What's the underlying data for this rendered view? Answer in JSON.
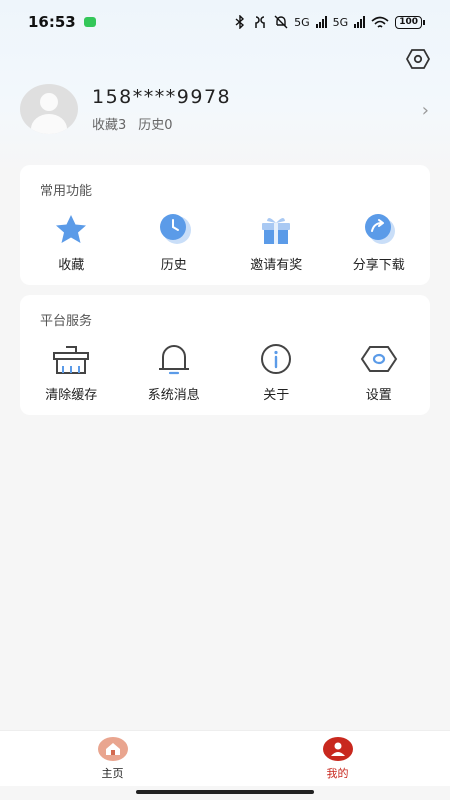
{
  "status_bar": {
    "time": "16:53",
    "network": "5G",
    "network2": "5G",
    "battery": "100"
  },
  "profile": {
    "phone": "158****9978",
    "favorites": "收藏3",
    "history": "历史0"
  },
  "common_functions": {
    "title": "常用功能",
    "items": [
      {
        "label": "收藏",
        "icon": "star-icon"
      },
      {
        "label": "历史",
        "icon": "clock-icon"
      },
      {
        "label": "邀请有奖",
        "icon": "gift-icon"
      },
      {
        "label": "分享下载",
        "icon": "share-icon"
      }
    ]
  },
  "platform_services": {
    "title": "平台服务",
    "items": [
      {
        "label": "清除缓存",
        "icon": "broom-icon"
      },
      {
        "label": "系统消息",
        "icon": "bell-icon"
      },
      {
        "label": "关于",
        "icon": "info-icon"
      },
      {
        "label": "设置",
        "icon": "settings-icon"
      }
    ]
  },
  "bottom_nav": {
    "items": [
      {
        "label": "主页",
        "icon": "home-icon"
      },
      {
        "label": "我的",
        "icon": "user-icon",
        "active": true
      }
    ]
  },
  "colors": {
    "accent_blue": "#5b9be8",
    "active_red": "#c8281e"
  }
}
